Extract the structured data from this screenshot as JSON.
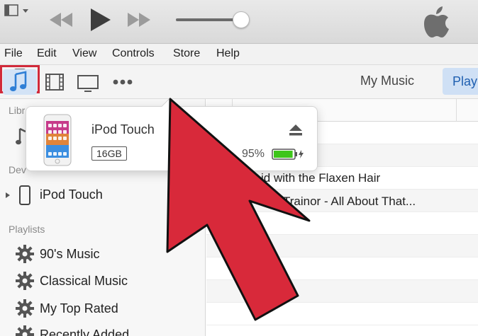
{
  "menu": {
    "items": [
      "File",
      "Edit",
      "View",
      "Controls",
      "Store",
      "Help"
    ]
  },
  "toolbar": {
    "my_music": "My Music",
    "playlists": "Playl"
  },
  "sidebar": {
    "library_head": "Libr",
    "devices_head": "Dev",
    "device_name": "iPod Touch",
    "playlists_head": "Playlists",
    "playlists": [
      "90's Music",
      "Classical Music",
      "My Top Rated",
      "Recently Added"
    ]
  },
  "content": {
    "songs": [
      "id with the Flaxen Hair",
      "Trainor - All About That..."
    ]
  },
  "popover": {
    "device_name": "iPod Touch",
    "capacity": "16GB",
    "battery_percent": "95%",
    "battery_level": 0.95
  },
  "colors": {
    "accent_blue": "#2f7fd6",
    "highlight_red": "#d12a3a",
    "arrow_fill": "#d8293a",
    "battery_green": "#3ec51a"
  },
  "icons": {
    "sidebar_toggle": "sidebar-toggle-icon",
    "prev": "rewind-icon",
    "play": "play-icon",
    "next": "fast-forward-icon",
    "apple": "apple-logo-icon",
    "music": "music-note-icon",
    "movies": "film-strip-icon",
    "tv": "tv-icon",
    "more": "more-dots-icon",
    "device": "iphone-icon",
    "eject": "eject-icon",
    "gear": "gear-icon"
  }
}
